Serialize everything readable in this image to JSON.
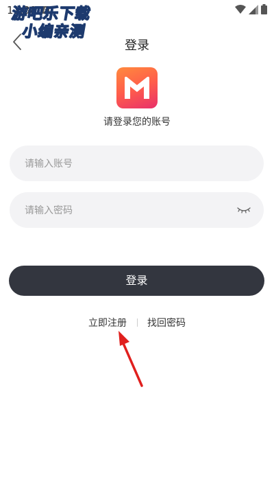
{
  "status_bar": {
    "time": "11:38",
    "notification_icon": "A"
  },
  "watermark": {
    "line1": "游吧乐下载",
    "line2": "小编亲测"
  },
  "header": {
    "title": "登录"
  },
  "login": {
    "subtitle": "请登录您的账号",
    "account_placeholder": "请输入账号",
    "password_placeholder": "请输入密码",
    "login_button": "登录"
  },
  "links": {
    "register": "立即注册",
    "forgot_password": "找回密码"
  },
  "colors": {
    "button_bg": "#33363f",
    "input_bg": "#f3f3f5",
    "logo_gradient_start": "#ff8a3d",
    "logo_gradient_end": "#e8306a",
    "annotation_arrow": "#e0201e"
  },
  "icons": [
    "back-arrow-icon",
    "app-logo-m-icon",
    "eye-closed-icon",
    "wifi-icon",
    "signal-icon",
    "battery-icon"
  ]
}
